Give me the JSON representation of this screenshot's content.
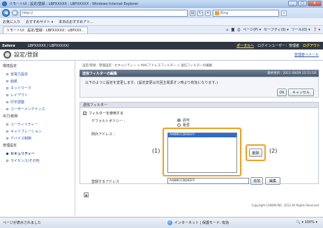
{
  "window": {
    "title": "リモートUI : 設定/登録 : LBPXXXXX : LBPXXXXX - Windows Internet Explorer",
    "minimize": "_",
    "maximize": "□",
    "close": "X"
  },
  "address": {
    "url": "http://",
    "search_placeholder": "Bing"
  },
  "favorites": {
    "label": "お気に入り",
    "suggested": "おすすめサイト ▾",
    "today": "本日のおすすめアト..."
  },
  "tab": {
    "label": "リモートUI：設定/登録：LBPXXXXX：LBPXXX..."
  },
  "command_bar": {
    "page": "ページ(P) ▾",
    "safety": "セーフティ(S) ▾",
    "tools": "ツール(O) ▾",
    "help": "❓ ▾"
  },
  "satera": {
    "brand": "Satera",
    "device": "LBPXXXXX / LBPXXXXX/",
    "portal": "ポータルへ",
    "login_user": "ログインユーザー：管理者",
    "logout": "ログアウト"
  },
  "page": {
    "title": "設定/登録",
    "admin_mail": "管理者へメール"
  },
  "sidebar": {
    "env_section": "環境設定",
    "env_items": [
      "省電力設定",
      "給紙",
      "ネットワーク",
      "レイアウト",
      "印字調整",
      "ユーザーメンテナンス"
    ],
    "io_section": "出力/削除",
    "io_items": [
      "ユーティリティー",
      "キャリブレーション",
      "デバイス制御"
    ],
    "mgmt_section": "管理設定",
    "mgmt_items": [
      "セキュリティー",
      "ライセンス/その他"
    ]
  },
  "breadcrumb": "設定/登録 : 管理設定 : セキュリティー > MACアドレスフィルター > 送信フィルターの編集",
  "panel": {
    "title": "送信フィルターの編集",
    "updated": "最終更新 : 2011 09/29 15:51:18",
    "message": "以下のように設定を変更します。(設定変更は次回主電源オン時より有効になります。)",
    "ok": "OK",
    "cancel": "キャンセル"
  },
  "filter": {
    "heading": "送信フィルター",
    "use_filter": "フィルターを使用する",
    "checkmark": "✓",
    "policy_label": "デフォルトポリシー :",
    "permit": "許可",
    "deny": "拒否",
    "exception_label": "例外アドレス :",
    "exception_addresses": [
      "AABBCCDDEEFF"
    ],
    "delete": "削除",
    "register_label": "登録するアドレス",
    "register_value": "AABBCCDDEEFF",
    "add": "追加",
    "edit": "編集"
  },
  "callouts": {
    "one": "(1)",
    "two": "(2)"
  },
  "footer": {
    "copyright": "Copyright CANON INC. 2012 All Rights Reserved",
    "top_glyph": "▲"
  },
  "status": {
    "left": "ページが表示されました",
    "zone": "インターネット | 保護モード: 有効",
    "zoom": "🔍 ▾ 100% ▾"
  }
}
